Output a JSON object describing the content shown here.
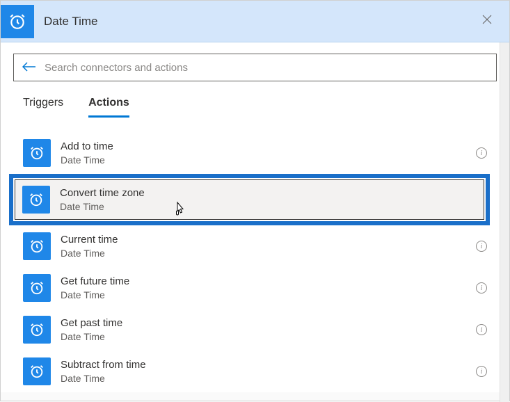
{
  "header": {
    "title": "Date Time",
    "icon_name": "clock-icon"
  },
  "search": {
    "placeholder": "Search connectors and actions"
  },
  "tabs": {
    "triggers": "Triggers",
    "actions": "Actions",
    "active": "actions"
  },
  "connector_name": "Date Time",
  "actions": [
    {
      "title": "Add to time",
      "sub": "Date Time",
      "highlighted": false
    },
    {
      "title": "Convert time zone",
      "sub": "Date Time",
      "highlighted": true
    },
    {
      "title": "Current time",
      "sub": "Date Time",
      "highlighted": false
    },
    {
      "title": "Get future time",
      "sub": "Date Time",
      "highlighted": false
    },
    {
      "title": "Get past time",
      "sub": "Date Time",
      "highlighted": false
    },
    {
      "title": "Subtract from time",
      "sub": "Date Time",
      "highlighted": false
    }
  ]
}
